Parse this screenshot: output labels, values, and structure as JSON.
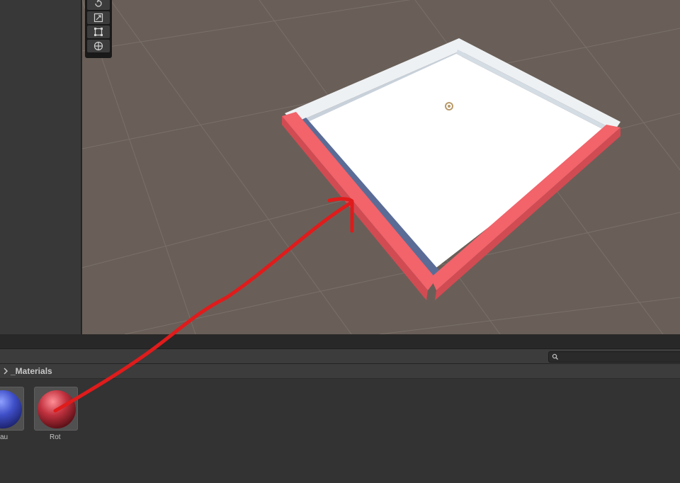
{
  "project_browser": {
    "breadcrumb": {
      "folder": "_Materials"
    },
    "search": {
      "placeholder": ""
    },
    "assets": [
      {
        "label": "Blau",
        "visible_label": "au",
        "color": "#3f4fc8"
      },
      {
        "label": "Rot",
        "visible_label": "Rot",
        "color": "#c0313e"
      }
    ]
  },
  "scene": {
    "toolbar": {
      "tools": [
        {
          "name": "rotate-tool",
          "icon": "rotate-icon"
        },
        {
          "name": "scale-tool",
          "icon": "scale-icon"
        },
        {
          "name": "rect-tool",
          "icon": "rect-transform-icon"
        },
        {
          "name": "transform-tool",
          "icon": "transform-icon"
        }
      ]
    },
    "colors": {
      "background": "#695f58",
      "grid": "#7b716a",
      "floor": "#ffffff",
      "wall_white": "#eef1f4",
      "wall_red": "#f2636a",
      "wall_red_shadow": "#d14b53",
      "inner_shadow": "#5a6c96"
    }
  },
  "annotation": {
    "color": "#e01b1b",
    "icon": "drag-arrow"
  }
}
